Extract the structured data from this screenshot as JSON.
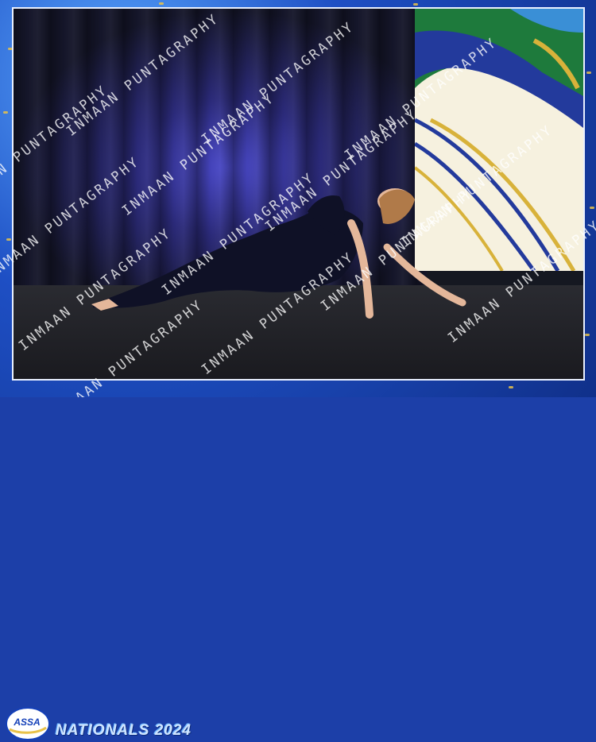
{
  "photo": {
    "description_free": true
  },
  "watermark": {
    "lines": [
      "INMAAN PUNTAGRAPHY",
      "INMAAN PUNTAGRAPHY",
      "INMAAN PUNTAGRAPHY",
      "INMAAN PUNTAGRAPHY",
      "INMAAN PUNTAGRAPHY",
      "INMAAN PUNTAGRAPHY",
      "INMAAN PUNTAGRAPHY",
      "INMAAN PUNTAGRAPHY",
      "INMAAN PUNTAGRAPHY",
      "INMAAN PUNTAGRAPHY",
      "INMAAN PUNTAGRAPHY",
      "INMAAN PUNTAGRAPHY",
      "INMAAN PUNTAGRAPHY",
      "INMAAN PUNTAGRAPHY"
    ]
  },
  "footer": {
    "logo_text": "ASSA",
    "event_title": "NATIONALS 2024"
  },
  "colors": {
    "frame": "#1e4fc4",
    "gold": "#e8c24a",
    "curtain_light": "#4a49c9"
  }
}
